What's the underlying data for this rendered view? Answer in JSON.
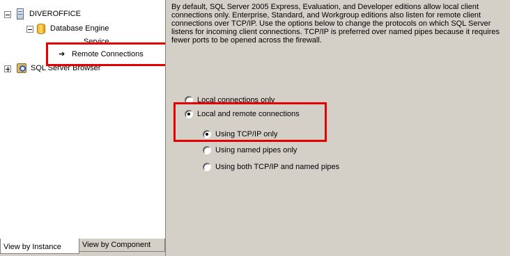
{
  "tree": {
    "server": {
      "label": "DIVEROFFICE",
      "icon": "server-icon"
    },
    "database_engine": {
      "label": "Database Engine",
      "icon": "database-icon"
    },
    "service": {
      "label": "Service"
    },
    "remote_connections": {
      "label": "Remote Connections",
      "icon": "arrow-right-icon",
      "arrow": "➔"
    },
    "sql_server_browser": {
      "label": "SQL Server Browser",
      "icon": "browser-icon"
    }
  },
  "tabs": [
    {
      "label": "View by Instance",
      "active": true
    },
    {
      "label": "View by Component",
      "active": false
    }
  ],
  "description": "By default, SQL Server 2005 Express, Evaluation, and Developer editions allow local client connections only. Enterprise, Standard, and Workgroup editions also listen for remote client connections over TCP/IP. Use the options below to change the protocols on which SQL Server listens for incoming client connections. TCP/IP is preferred over named pipes because it requires fewer ports to be opened across the firewall.",
  "options": {
    "local_only": {
      "label": "Local connections only",
      "checked": false
    },
    "local_and_remote": {
      "label": "Local and remote connections",
      "checked": true
    },
    "tcp_only": {
      "label": "Using TCP/IP only",
      "checked": true
    },
    "named_pipes_only": {
      "label": "Using named pipes only",
      "checked": false
    },
    "both": {
      "label": "Using both TCP/IP and named pipes",
      "checked": false
    }
  },
  "colors": {
    "highlight_border": "#e60000",
    "panel_background": "#d4d0c8"
  }
}
